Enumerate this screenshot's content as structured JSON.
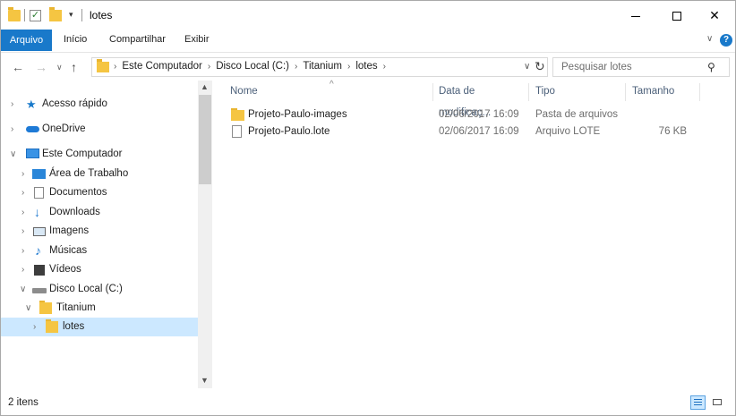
{
  "window": {
    "title": "lotes",
    "quick_access_dropdown": "▾"
  },
  "ribbon": {
    "tabs": [
      "Arquivo",
      "Início",
      "Compartilhar",
      "Exibir"
    ],
    "help": "?"
  },
  "address": {
    "crumbs": [
      "Este Computador",
      "Disco Local (C:)",
      "Titanium",
      "lotes"
    ],
    "search_placeholder": "Pesquisar lotes"
  },
  "nav": {
    "items": [
      {
        "label": "Acesso rápido",
        "icon": "star-icon",
        "level": 0
      },
      {
        "label": "OneDrive",
        "icon": "cloud-icon",
        "level": 0
      },
      {
        "label": "Este Computador",
        "icon": "computer-icon",
        "level": 0,
        "expanded": true
      },
      {
        "label": "Área de Trabalho",
        "icon": "desktop-icon",
        "level": 1
      },
      {
        "label": "Documentos",
        "icon": "documents-icon",
        "level": 1
      },
      {
        "label": "Downloads",
        "icon": "downloads-icon",
        "level": 1
      },
      {
        "label": "Imagens",
        "icon": "pictures-icon",
        "level": 1
      },
      {
        "label": "Músicas",
        "icon": "music-icon",
        "level": 1
      },
      {
        "label": "Vídeos",
        "icon": "videos-icon",
        "level": 1
      },
      {
        "label": "Disco Local (C:)",
        "icon": "drive-icon",
        "level": 1,
        "expanded": true
      },
      {
        "label": "Titanium",
        "icon": "folder-icon",
        "level": 2,
        "expanded": true
      },
      {
        "label": "lotes",
        "icon": "folder-icon",
        "level": 3,
        "selected": true
      }
    ]
  },
  "list": {
    "columns": [
      "Nome",
      "Data de modificaç...",
      "Tipo",
      "Tamanho"
    ],
    "rows": [
      {
        "name": "Projeto-Paulo-images",
        "modified": "02/06/2017 16:09",
        "type": "Pasta de arquivos",
        "size": "",
        "icon": "folder-icon"
      },
      {
        "name": "Projeto-Paulo.lote",
        "modified": "02/06/2017 16:09",
        "type": "Arquivo LOTE",
        "size": "76 KB",
        "icon": "file-icon"
      }
    ]
  },
  "status": {
    "item_count": "2 itens"
  },
  "colors": {
    "accent": "#1979ca",
    "selection": "#cce8ff",
    "folder": "#f5c542"
  }
}
